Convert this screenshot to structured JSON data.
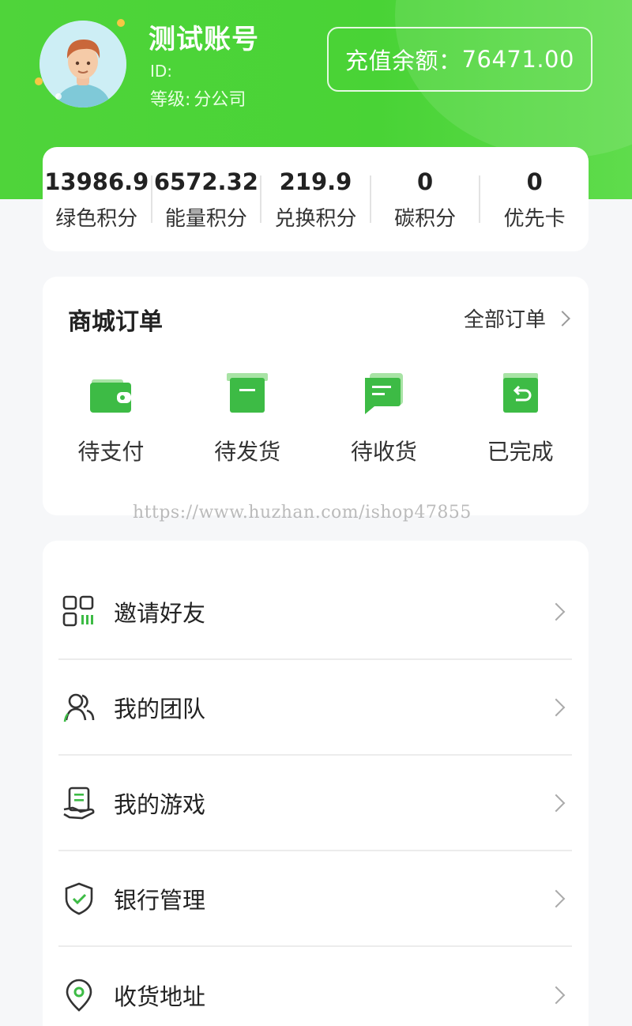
{
  "profile": {
    "username": "测试账号",
    "id_label": "ID:",
    "level_label": "等级:",
    "level_value": "分公司",
    "balance_label": "充值余额：",
    "balance_value": "76471.00"
  },
  "stats": [
    {
      "value": "13986.9",
      "label": "绿色积分"
    },
    {
      "value": "6572.32",
      "label": "能量积分"
    },
    {
      "value": "219.9",
      "label": "兑换积分"
    },
    {
      "value": "0",
      "label": "碳积分"
    },
    {
      "value": "0",
      "label": "优先卡"
    }
  ],
  "orders": {
    "title": "商城订单",
    "all_label": "全部订单",
    "items": [
      {
        "label": "待支付",
        "icon": "wallet-icon"
      },
      {
        "label": "待发货",
        "icon": "box-icon"
      },
      {
        "label": "待收货",
        "icon": "message-icon"
      },
      {
        "label": "已完成",
        "icon": "return-icon"
      }
    ]
  },
  "watermark": "https://www.huzhan.com/ishop47855",
  "menu": [
    {
      "label": "邀请好友",
      "icon": "qrcode-icon"
    },
    {
      "label": "我的团队",
      "icon": "team-icon"
    },
    {
      "label": "我的游戏",
      "icon": "game-icon"
    },
    {
      "label": "银行管理",
      "icon": "shield-check-icon"
    },
    {
      "label": "收货地址",
      "icon": "location-icon"
    }
  ],
  "colors": {
    "brand_green": "#4cd338",
    "icon_green": "#3dbb45",
    "background": "#f6f7f9"
  }
}
